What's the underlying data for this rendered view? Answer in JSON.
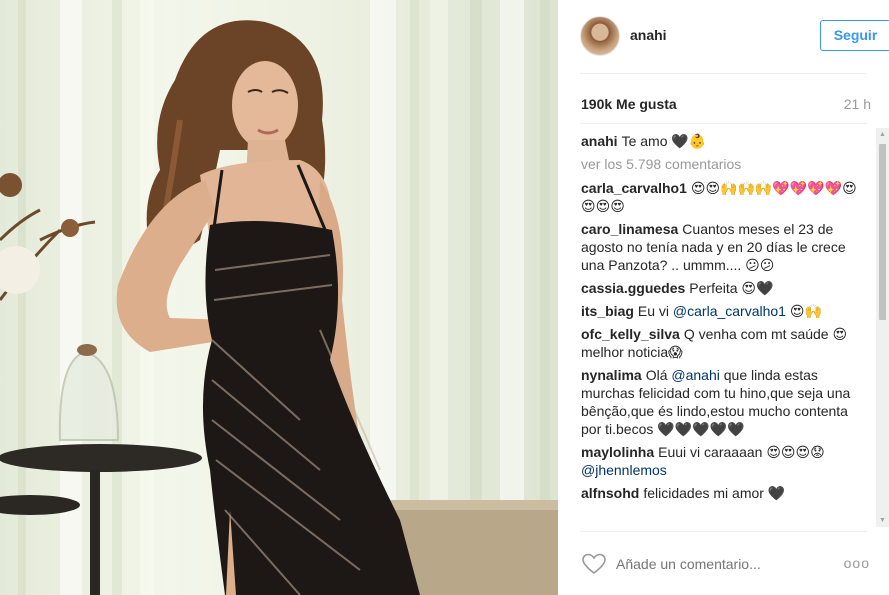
{
  "post": {
    "username": "anahi",
    "follow_label": "Seguir",
    "likes": "190k Me gusta",
    "time": "21 h",
    "caption": {
      "user": "anahi",
      "text": "Te amo 🖤👶"
    },
    "view_all": "ver los 5.798 comentarios",
    "comments": [
      {
        "user": "carla_carvalho1",
        "text": "😍😍🙌🙌🙌💖💖💖💖😍😍😍😍"
      },
      {
        "user": "caro_linamesa",
        "text": "Cuantos meses el 23 de agosto no tenía nada y en 20 días le crece una Panzota? .. ummm.... 😕😕"
      },
      {
        "user": "cassia.gguedes",
        "text": "Perfeita 😍🖤"
      },
      {
        "user": "its_biag",
        "text_before": "Eu vi",
        "mention": "@carla_carvalho1",
        "text_after": "😍🙌"
      },
      {
        "user": "ofc_kelly_silva",
        "text": "Q venha com mt saúde 😍 melhor noticia😱"
      },
      {
        "user": "nynalima",
        "text_before": "Olá",
        "mention": "@anahi",
        "text_after": "que linda estas murchas felicidad com tu hino,que seja una bênção,que és lindo,estou mucho contenta por ti.becos 🖤🖤🖤🖤🖤"
      },
      {
        "user": "maylolinha",
        "text_before": "Euui vi caraaaan 😍😍😍😟",
        "mention": "@jhennlemos",
        "text_after": ""
      },
      {
        "user": "alfnsohd",
        "text": "felicidades mi amor 🖤"
      }
    ],
    "comment_placeholder": "Añade un comentario...",
    "more_label": "ooo"
  },
  "colors": {
    "accent": "#3897f0",
    "mention": "#003569",
    "muted": "#999999",
    "text": "#262626"
  },
  "icons": {
    "like": "heart-icon",
    "options": "more-options-icon"
  }
}
